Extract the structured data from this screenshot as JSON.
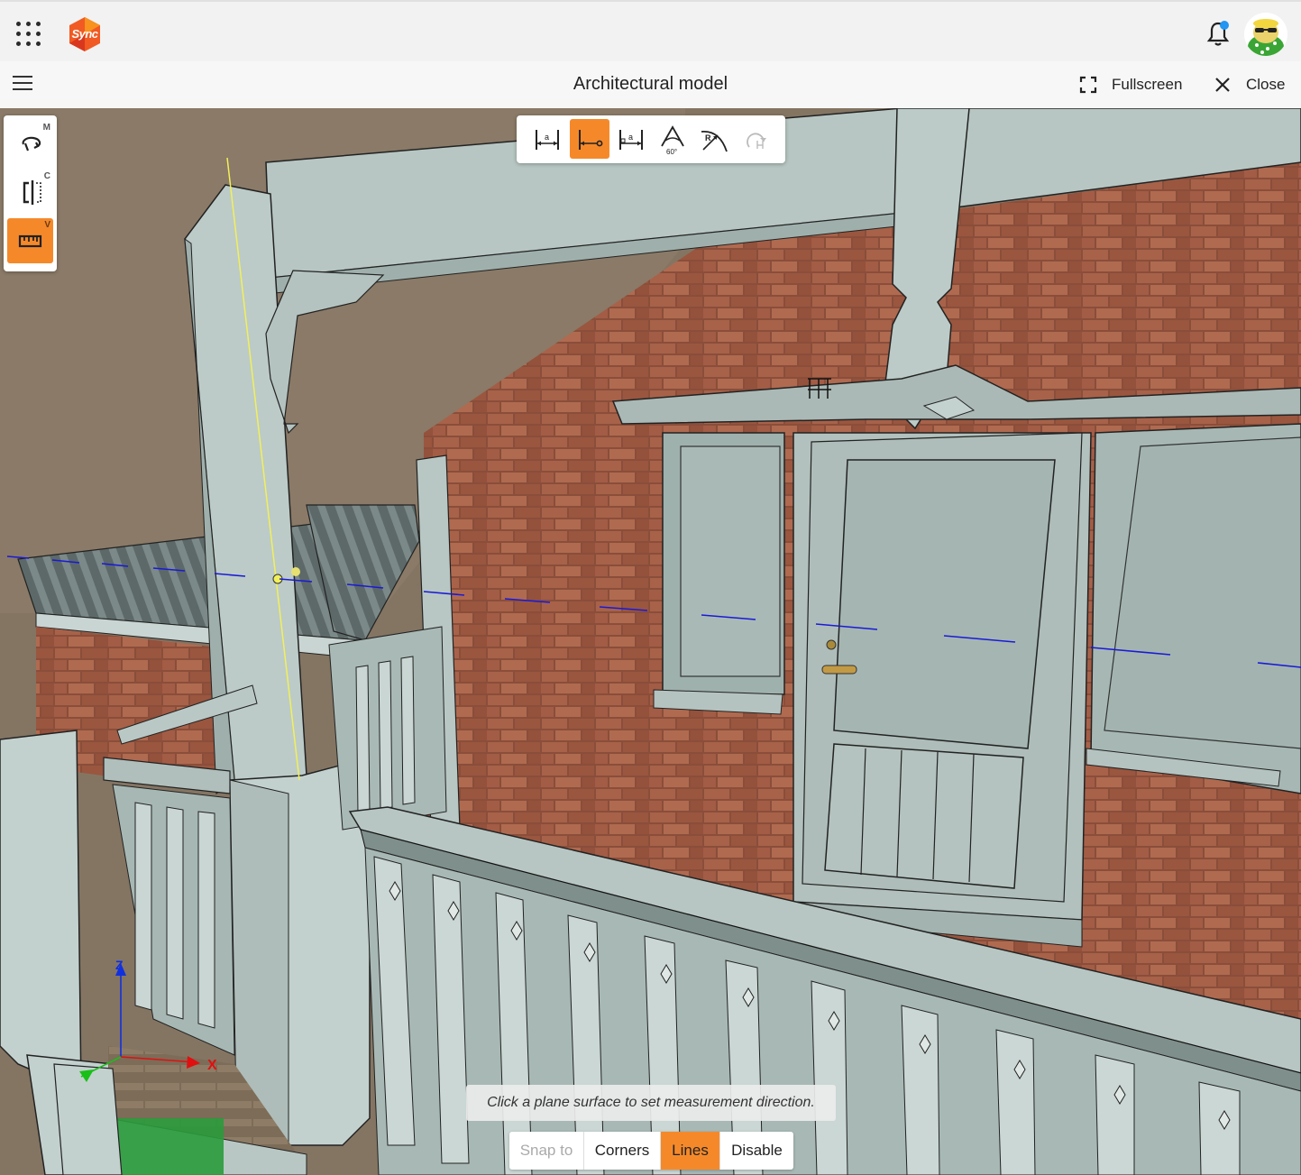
{
  "app": {
    "logo_text": "Sync",
    "notification_dot": true
  },
  "header": {
    "title": "Architectural model",
    "fullscreen_label": "Fullscreen",
    "close_label": "Close"
  },
  "palette": {
    "items": [
      {
        "icon": "orbit-icon",
        "shortcut": "M",
        "active": false
      },
      {
        "icon": "section-cut-icon",
        "shortcut": "C",
        "active": false
      },
      {
        "icon": "ruler-icon",
        "shortcut": "V",
        "active": true
      }
    ]
  },
  "measure_tools": {
    "items": [
      {
        "icon": "distance-icon",
        "glyph": "a",
        "active": false
      },
      {
        "icon": "point-to-line-icon",
        "active": true
      },
      {
        "icon": "perpendicular-distance-icon",
        "glyph": "a",
        "active": false
      },
      {
        "icon": "angle-icon",
        "glyph": "60°",
        "active": false
      },
      {
        "icon": "radius-icon",
        "glyph": "R",
        "active": false
      },
      {
        "icon": "clear-measurements-icon",
        "active": false,
        "disabled": true
      }
    ]
  },
  "axes": {
    "x": "X",
    "z": "Z"
  },
  "hint": "Click a plane surface to set measurement direction.",
  "snap": {
    "label": "Snap to",
    "options": [
      {
        "label": "Corners",
        "active": false
      },
      {
        "label": "Lines",
        "active": true
      },
      {
        "label": "Disable",
        "active": false
      }
    ]
  },
  "colors": {
    "accent": "#f5892a",
    "guide_line": "#f2f05a",
    "measure_lines": "#1a1ad6",
    "axis_x": "#e01010",
    "axis_y": "#18c018",
    "axis_z": "#1030e0"
  }
}
